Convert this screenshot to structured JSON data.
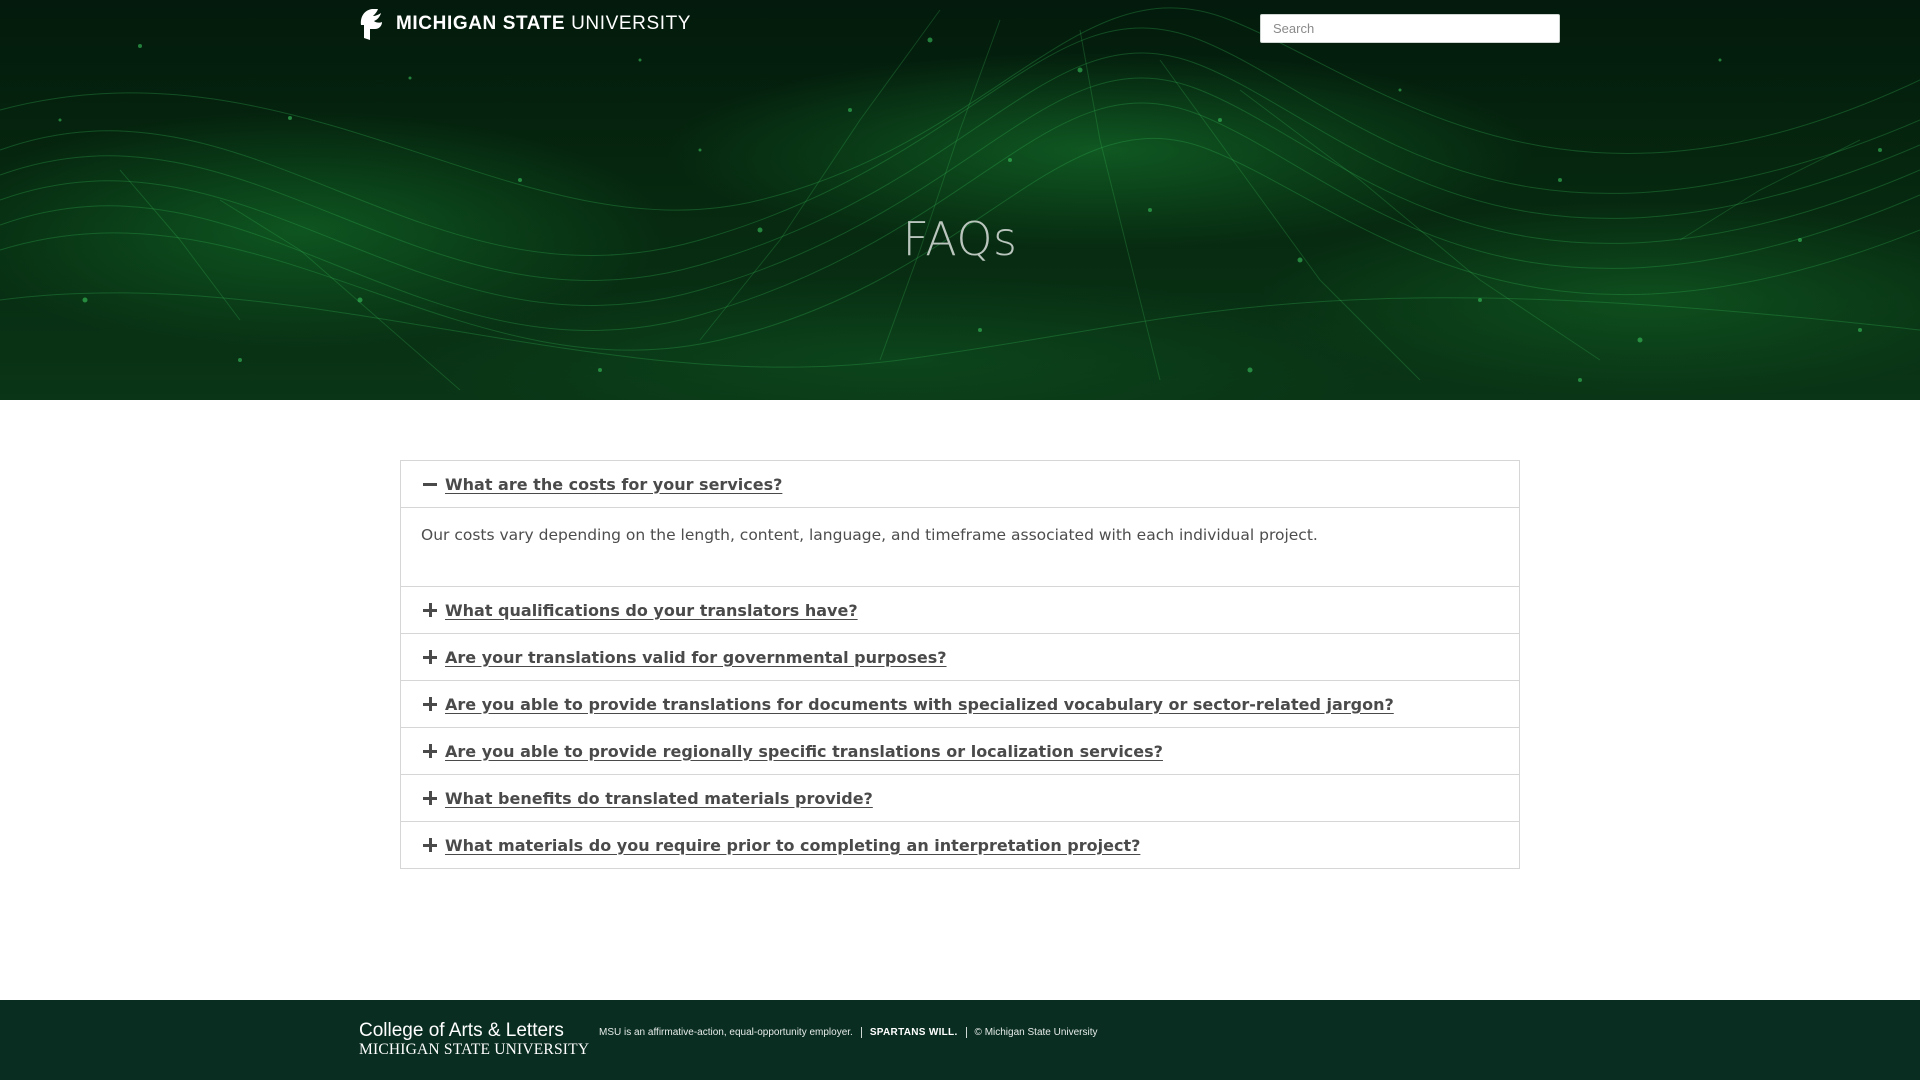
{
  "header": {
    "brand_bold": "MICHIGAN STATE",
    "brand_thin": " UNIVERSITY",
    "logo_icon": "spartan-helmet-icon",
    "search_placeholder": "Search"
  },
  "hero": {
    "title": "FAQs"
  },
  "faq": {
    "items": [
      {
        "question": "What are the costs for your services?",
        "expanded": true,
        "answer": "Our costs vary depending on the length, content, language, and timeframe associated with each individual project."
      },
      {
        "question": "What qualifications do your translators have?",
        "expanded": false
      },
      {
        "question": "Are your translations valid for governmental purposes?",
        "expanded": false
      },
      {
        "question": "Are you able to provide translations for documents with specialized vocabulary or sector-related jargon?",
        "expanded": false
      },
      {
        "question": "Are you able to provide regionally specific translations or localization services?",
        "expanded": false
      },
      {
        "question": "What benefits do translated materials provide?",
        "expanded": false
      },
      {
        "question": "What materials do you require prior to completing an interpretation project?",
        "expanded": false
      }
    ]
  },
  "footer": {
    "college": "College of Arts & Letters",
    "university": "MICHIGAN STATE UNIVERSITY",
    "employer_note": "MSU is an affirmative-action, equal-opportunity employer.",
    "spartans": "SPARTANS WILL.",
    "copyright": "© Michigan State University"
  },
  "colors": {
    "footer_bg": "#0a2d22",
    "hero_green": "#1f8a3a",
    "text": "#4a4a4a"
  }
}
